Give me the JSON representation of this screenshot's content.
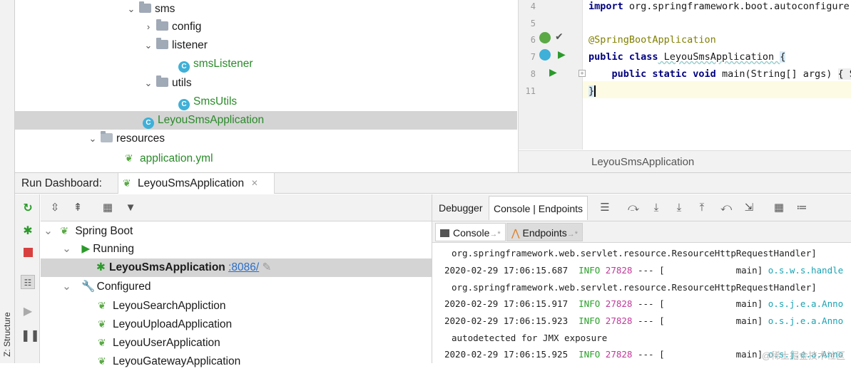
{
  "side_strip": {
    "label": "Z: Structure"
  },
  "project_tree": {
    "rows": [
      {
        "label": "sms",
        "arrow": "⌄",
        "type": "folder"
      },
      {
        "label": "config",
        "arrow": "›",
        "type": "folder"
      },
      {
        "label": "listener",
        "arrow": "⌄",
        "type": "folder"
      },
      {
        "label": "smsListener",
        "type": "class"
      },
      {
        "label": "utils",
        "arrow": "⌄",
        "type": "folder"
      },
      {
        "label": "SmsUtils",
        "type": "class"
      },
      {
        "label": "LeyouSmsApplication",
        "type": "springclass",
        "selected": true
      },
      {
        "label": "resources",
        "arrow": "⌄",
        "type": "resources"
      },
      {
        "label": "application.yml",
        "type": "yml"
      }
    ]
  },
  "editor": {
    "lines": [
      {
        "num": "4",
        "text": "import org.springframework.boot.autoconfigure."
      },
      {
        "num": "5",
        "text": ""
      },
      {
        "num": "6",
        "text": "@SpringBootApplication"
      },
      {
        "num": "7",
        "text": "public class LeyouSmsApplication {"
      },
      {
        "num": "8",
        "text": "    public static void main(String[] args) { S"
      },
      {
        "num": "11",
        "text": "}"
      }
    ],
    "code_parts": {
      "l4_kw": "import",
      "l4_rest": " org.springframework.boot.autoconfigure.",
      "l6_ann": "@SpringBootApplication",
      "l7_kw": "public class",
      "l7_name": " LeyouSmsApplication ",
      "l7_brace": "{",
      "l8_indent": "    ",
      "l8_kw": "public static void",
      "l8_rest": " main(String[] args) ",
      "l8_brace": "{ S",
      "l11": "}"
    },
    "footer": "LeyouSmsApplication"
  },
  "run_dashboard": {
    "title": "Run Dashboard:",
    "tab_label": "LeyouSmsApplication",
    "tab_close": "×"
  },
  "services": {
    "spring_boot": "Spring Boot",
    "running": "Running",
    "running_app": "LeyouSmsApplication",
    "running_port": ":8086/",
    "configured": "Configured",
    "configured_apps": [
      "LeyouSearchAppliction",
      "LeyouUploadApplication",
      "LeyouUserApplication",
      "LeyouGatewayApplication"
    ]
  },
  "console_panel": {
    "tabs": {
      "debugger": "Debugger",
      "console_endpoints": "Console | Endpoints"
    },
    "subtabs": {
      "console": "Console",
      "endpoints": "Endpoints",
      "pin": "→*"
    },
    "lines": [
      {
        "kind": "cont",
        "text": "org.springframework.web.servlet.resource.ResourceHttpRequestHandler]"
      },
      {
        "kind": "log",
        "ts": "2020-02-29 17:06:15.687",
        "level": "INFO",
        "pid": "27828",
        "sep": "--- [",
        "thread": "main]",
        "logger": "o.s.w.s.handle"
      },
      {
        "kind": "cont",
        "text": "org.springframework.web.servlet.resource.ResourceHttpRequestHandler]"
      },
      {
        "kind": "log",
        "ts": "2020-02-29 17:06:15.917",
        "level": "INFO",
        "pid": "27828",
        "sep": "--- [",
        "thread": "main]",
        "logger": "o.s.j.e.a.Anno"
      },
      {
        "kind": "log",
        "ts": "2020-02-29 17:06:15.923",
        "level": "INFO",
        "pid": "27828",
        "sep": "--- [",
        "thread": "main]",
        "logger": "o.s.j.e.a.Anno"
      },
      {
        "kind": "cont",
        "text": "autodetected for JMX exposure"
      },
      {
        "kind": "log",
        "ts": "2020-02-29 17:06:15.925",
        "level": "INFO",
        "pid": "27828",
        "sep": "--- [",
        "thread": "main]",
        "logger": "o.s.j.e.a.Anno"
      }
    ]
  },
  "watermark": "@稀土掘金技术社区",
  "colors": {
    "selection": "#d4d4d4",
    "spring_green": "#5aa945",
    "info_green": "#2aa02a",
    "pid_magenta": "#c0399b",
    "link_blue": "#2a6ec8",
    "keyword_navy": "#000080"
  }
}
